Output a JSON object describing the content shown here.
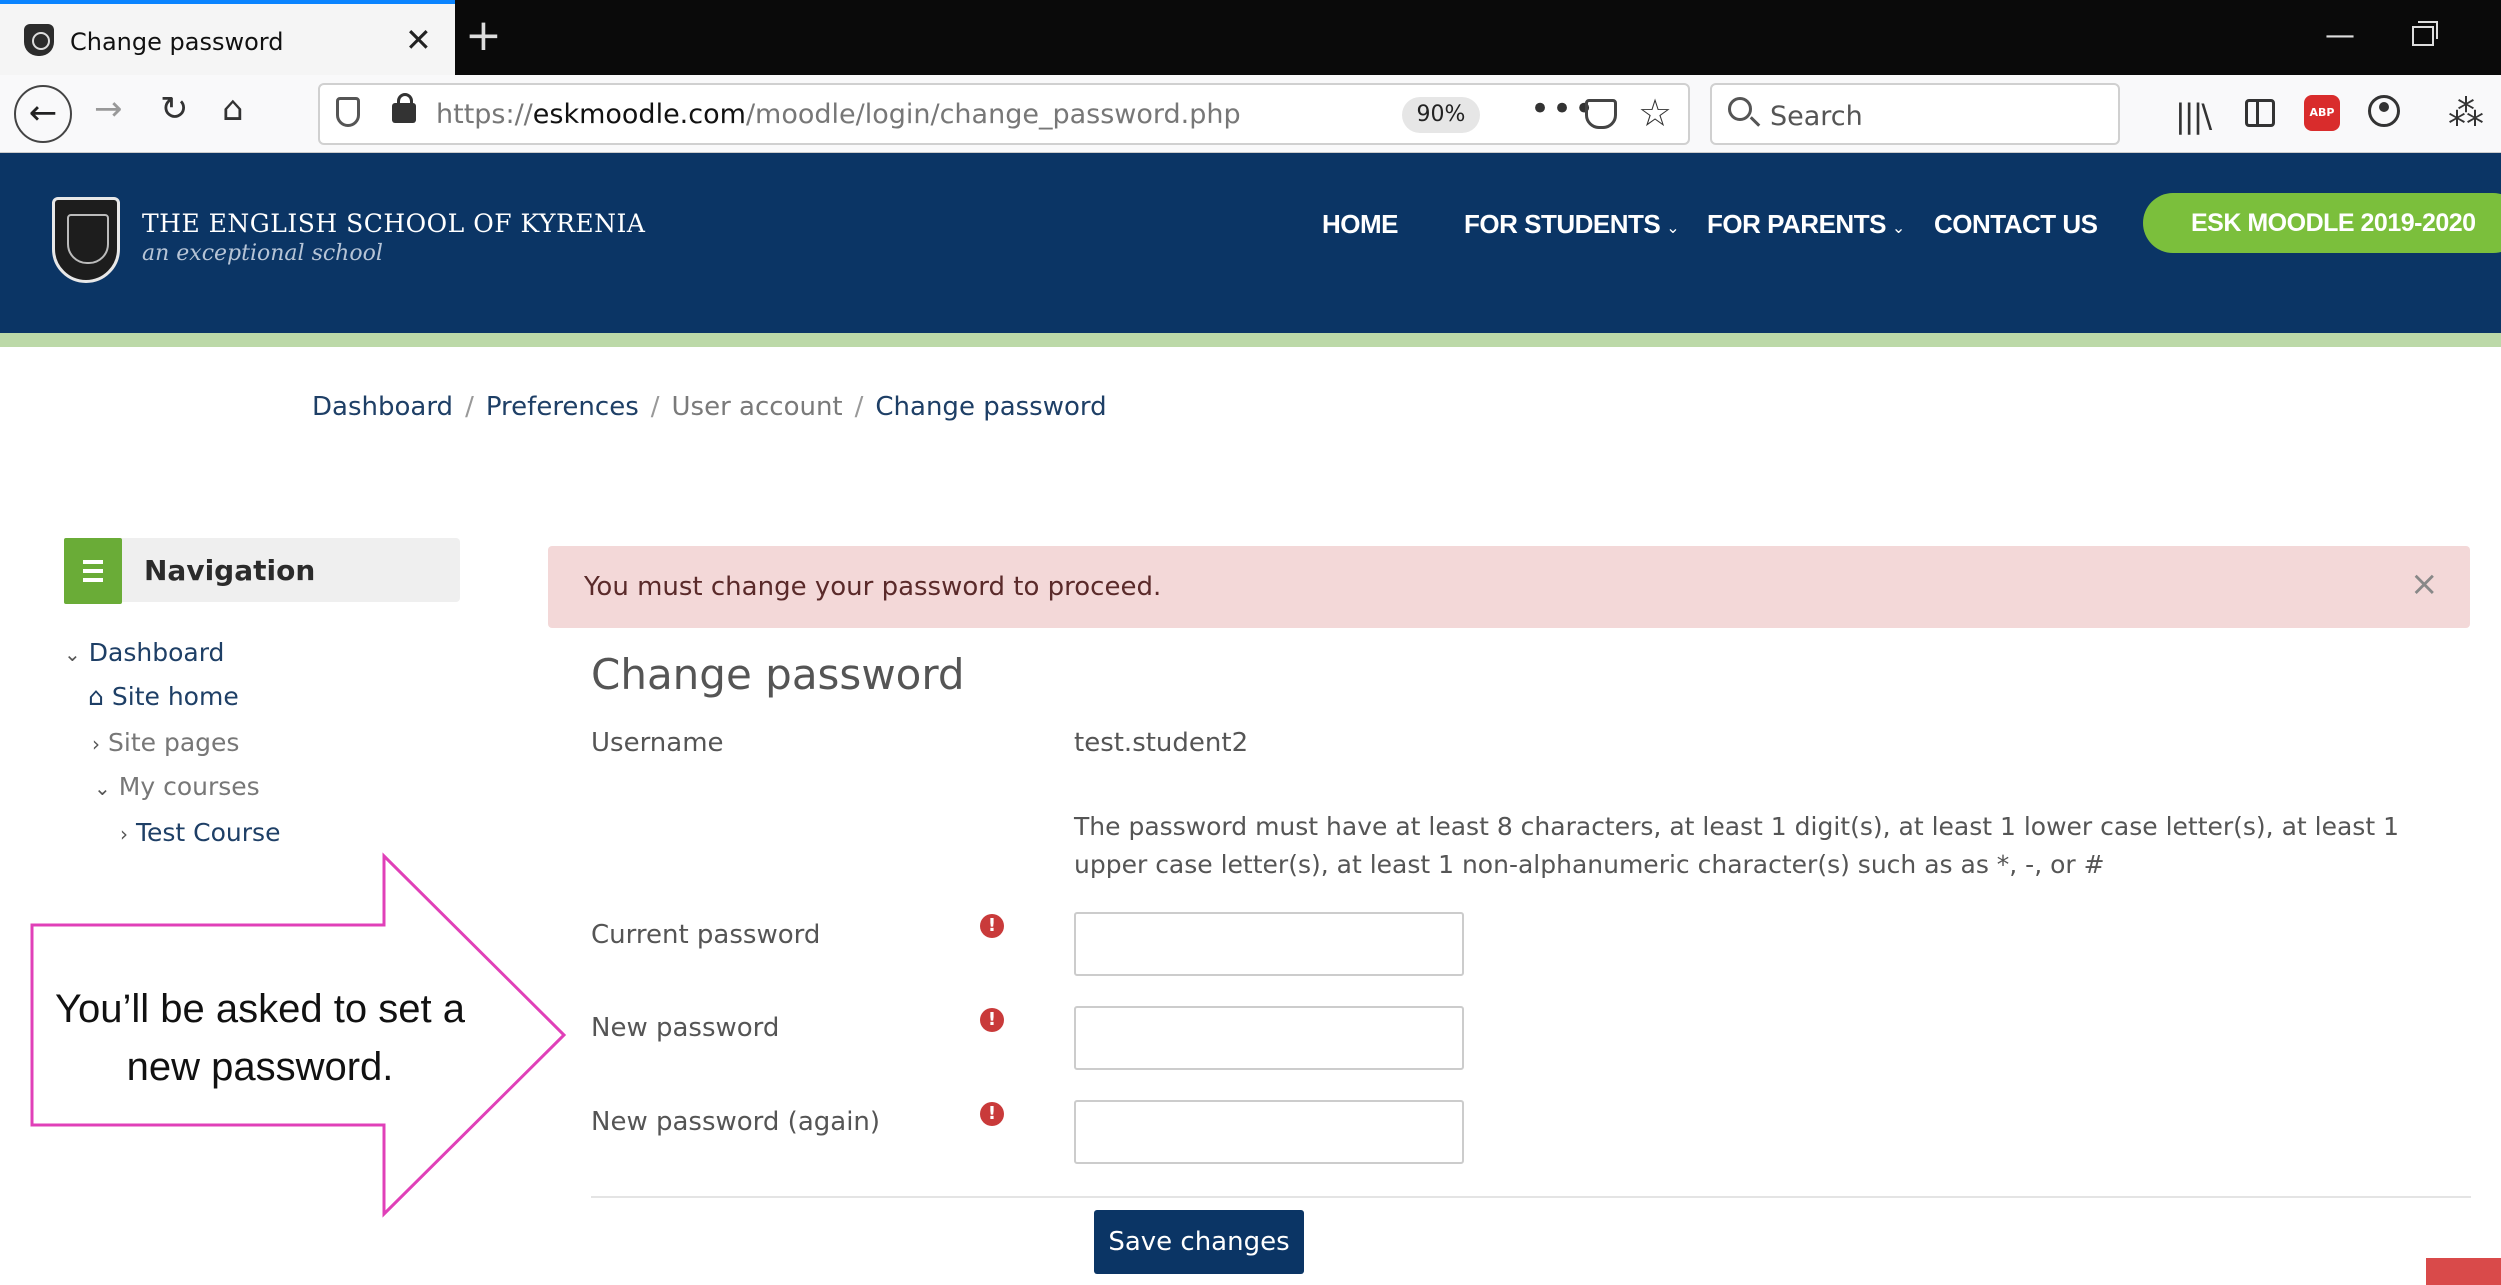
{
  "browser": {
    "tab_title": "Change password",
    "tab_close": "✕",
    "new_tab": "+",
    "url_prefix": "https://",
    "url_domain": "eskmoodle.com",
    "url_path": "/moodle/login/change_password.php",
    "zoom": "90%",
    "search_placeholder": "Search",
    "abp_label": "ABP"
  },
  "header": {
    "school_name": "THE ENGLISH SCHOOL OF KYRENIA",
    "tagline": "an exceptional school",
    "nav": [
      "HOME",
      "FOR STUDENTS",
      "FOR PARENTS",
      "CONTACT US"
    ],
    "nav_dropdown_marker": "⌄",
    "cta": "ESK MOODLE 2019-2020",
    "colors": {
      "primary": "#0b3565",
      "accent": "#7bbf3c"
    }
  },
  "breadcrumb": [
    "Dashboard",
    "Preferences",
    "User account",
    "Change password"
  ],
  "navigation": {
    "title": "Navigation",
    "items": [
      {
        "label": "Dashboard",
        "icon": "chevron-down-icon"
      },
      {
        "label": "Site home",
        "icon": "home-icon"
      },
      {
        "label": "Site pages",
        "icon": "chevron-right-icon"
      },
      {
        "label": "My courses",
        "icon": "chevron-down-icon"
      },
      {
        "label": "Test Course",
        "icon": "chevron-right-icon"
      }
    ]
  },
  "alert": {
    "message": "You must change your password to proceed.",
    "close": "×"
  },
  "form": {
    "title": "Change password",
    "username_label": "Username",
    "username_value": "test.student2",
    "policy": "The password must have at least 8 characters, at least 1 digit(s), at least 1 lower case letter(s), at least 1 upper case letter(s), at least 1 non-alphanumeric character(s) such as as *, -, or #",
    "fields": [
      {
        "label": "Current password",
        "value": ""
      },
      {
        "label": "New password",
        "value": ""
      },
      {
        "label": "New password (again)",
        "value": ""
      }
    ],
    "required_icon": "!",
    "submit": "Save changes"
  },
  "callout": {
    "text": "You’ll be asked to set a new password."
  }
}
